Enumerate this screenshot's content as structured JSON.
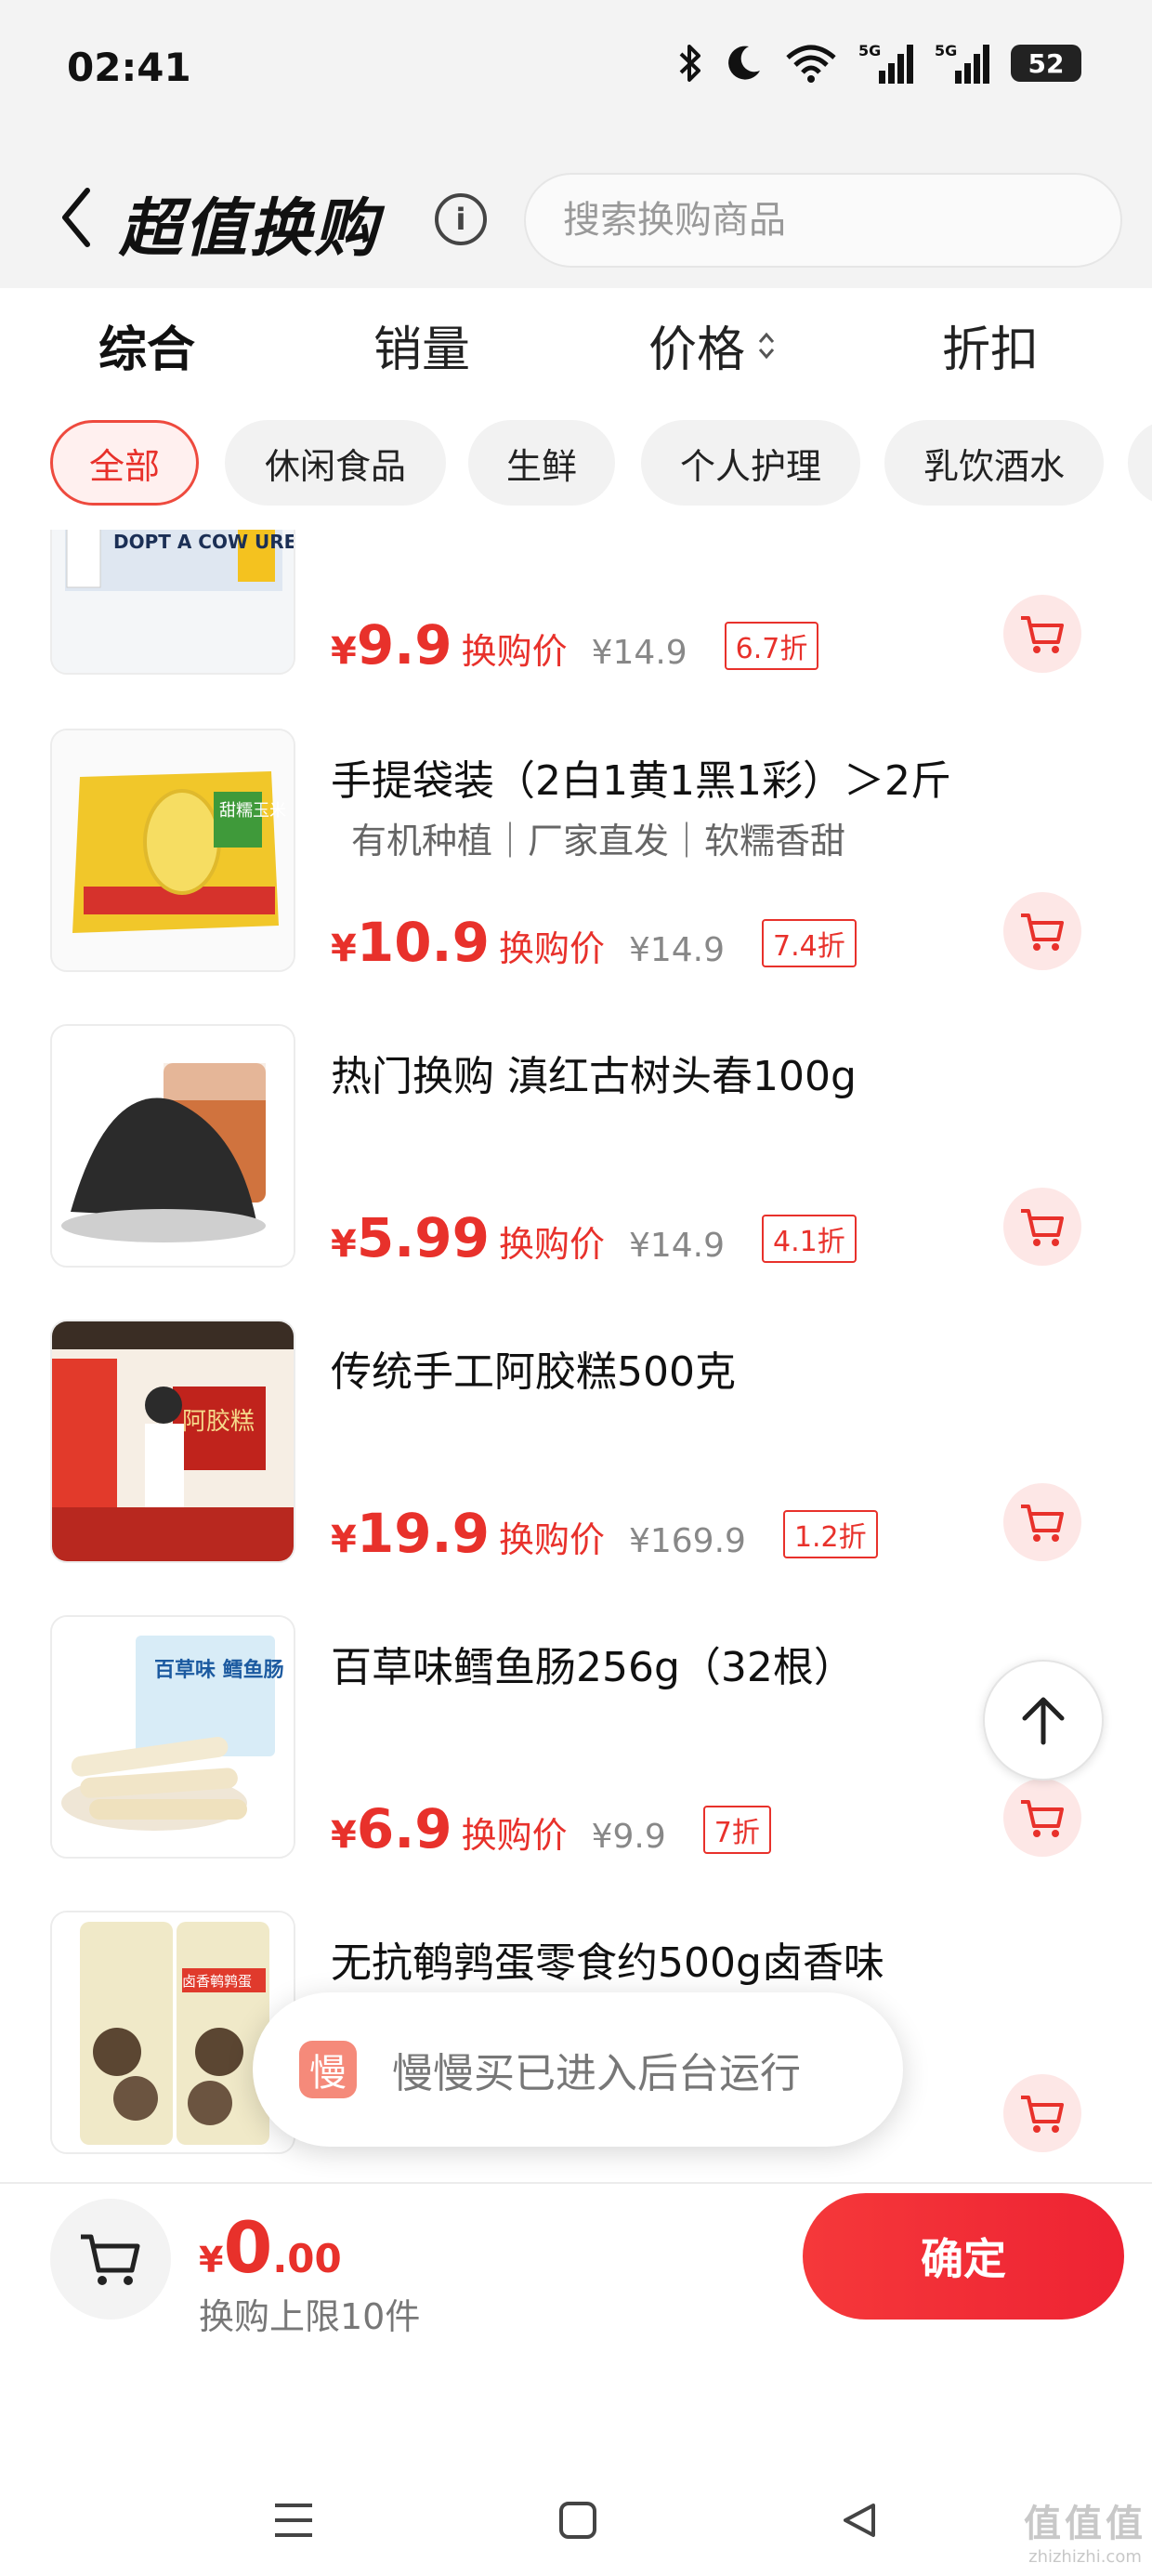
{
  "status_bar": {
    "time": "02:41",
    "battery": "52",
    "icons": [
      "bluetooth-icon",
      "moon-icon",
      "wifi-icon",
      "signal-5g-icon",
      "signal-5g-icon-2",
      "battery-icon"
    ]
  },
  "header": {
    "title": "超值换购",
    "search_placeholder": "搜索换购商品",
    "info_icon": "i"
  },
  "sort_tabs": [
    {
      "label": "综合",
      "active": true
    },
    {
      "label": "销量",
      "active": false
    },
    {
      "label": "价格",
      "active": false
    },
    {
      "label": "折扣",
      "active": false
    }
  ],
  "categories": [
    {
      "label": "全部",
      "active": true
    },
    {
      "label": "休闲食品",
      "active": false
    },
    {
      "label": "生鲜",
      "active": false
    },
    {
      "label": "个人护理",
      "active": false
    },
    {
      "label": "乳饮酒水",
      "active": false
    }
  ],
  "products": [
    {
      "title": "",
      "tags": "",
      "price": "9.9",
      "price_label": "换购价",
      "original": "¥14.9",
      "discount": "6.7折",
      "image_text": "DOPT A COW URE MILK"
    },
    {
      "title": "手提袋装（2白1黄1黑1彩）＞2斤",
      "tags": "有机种植｜厂家直发｜软糯香甜",
      "price": "10.9",
      "price_label": "换购价",
      "original": "¥14.9",
      "discount": "7.4折",
      "image_text": "甜糯玉米"
    },
    {
      "title": "热门换购 滇红古树头春100g",
      "tags": "",
      "price": "5.99",
      "price_label": "换购价",
      "original": "¥14.9",
      "discount": "4.1折",
      "image_text": ""
    },
    {
      "title": "传统手工阿胶糕500克",
      "tags": "",
      "price": "19.9",
      "price_label": "换购价",
      "original": "¥169.9",
      "discount": "1.2折",
      "image_text": "阿胶糕"
    },
    {
      "title": "百草味鳕鱼肠256g（32根）",
      "tags": "",
      "price": "6.9",
      "price_label": "换购价",
      "original": "¥9.9",
      "discount": "7折",
      "image_text": "百草味 鳕鱼肠"
    },
    {
      "title": "无抗鹌鹑蛋零食约500g卤香味",
      "tags": "",
      "price": "",
      "price_label": "",
      "original": "",
      "discount": "",
      "image_text": "卤香鹌鹑蛋"
    }
  ],
  "toast": {
    "icon_text": "慢",
    "text": "慢慢买已进入后台运行"
  },
  "bottom_bar": {
    "currency": "¥",
    "total_int": "0",
    "total_dec": ".00",
    "limit": "换购上限10件",
    "confirm": "确定"
  },
  "watermark": {
    "big": "值值值",
    "small": "zhizhizhi.com"
  },
  "colors": {
    "accent": "#e8312b",
    "chip_active_bg": "#fff0ef",
    "cart_bg": "#fde7e6",
    "header_bg": "#f3f3f3"
  }
}
